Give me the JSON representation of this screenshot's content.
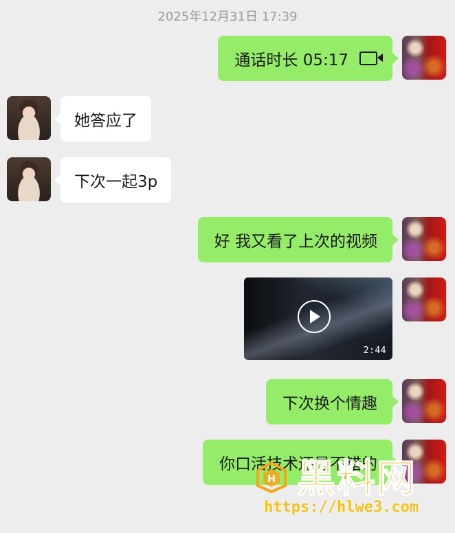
{
  "chat": {
    "timestamp": "2025年12月31日 17:39",
    "call": {
      "label": "通话时长 05:17",
      "icon": "video-call-icon"
    },
    "messages": [
      {
        "from": "contact",
        "text": "她答应了"
      },
      {
        "from": "contact",
        "text": "下次一起3p"
      },
      {
        "from": "me",
        "text": "好 我又看了上次的视频"
      },
      {
        "from": "me",
        "type": "video",
        "duration": "2:44"
      },
      {
        "from": "me",
        "text": "下次换个情趣"
      },
      {
        "from": "me",
        "text": "你口活技术还是不错的"
      }
    ],
    "bubble_colors": {
      "me": "#95ec69",
      "contact": "#ffffff",
      "background": "#ededed"
    }
  },
  "watermark": {
    "title": "黑料网",
    "url": "https://hlwe3.com",
    "color": "#f7a516"
  }
}
